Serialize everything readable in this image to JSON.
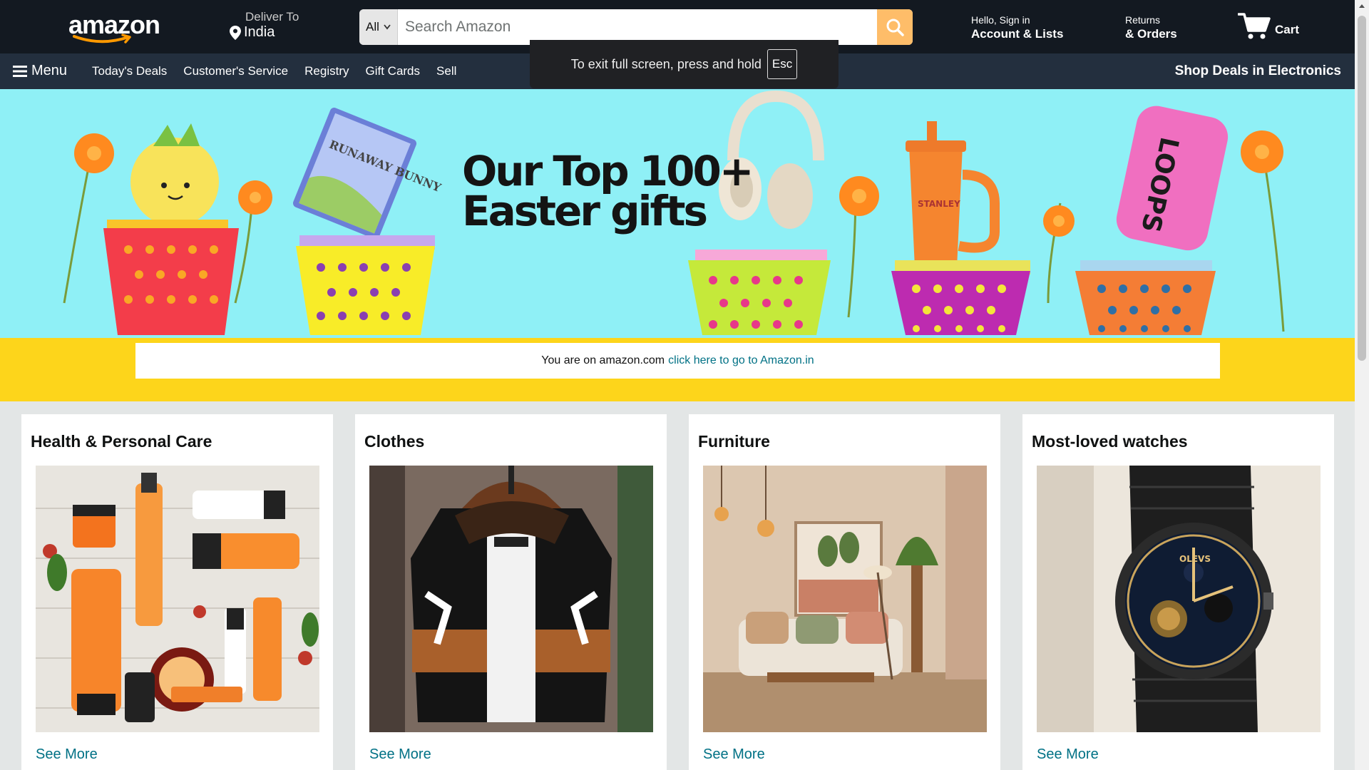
{
  "header": {
    "logo_text": "amazon",
    "deliver_label": "Deliver To",
    "deliver_location": "India",
    "search": {
      "category": "All",
      "placeholder": "Search Amazon"
    },
    "account": {
      "greeting": "Hello, Sign in",
      "label": "Account & Lists"
    },
    "orders": {
      "top": "Returns",
      "label": "& Orders"
    },
    "cart_label": "Cart"
  },
  "subnav": {
    "menu_label": "Menu",
    "links": [
      "Today's Deals",
      "Customer's Service",
      "Registry",
      "Gift Cards",
      "Sell"
    ],
    "promo": "Shop Deals in Electronics"
  },
  "fullscreen_toast": {
    "text": "To exit full screen, press and hold",
    "key": "Esc"
  },
  "hero": {
    "title_line1": "Our Top 100+",
    "title_line2": "Easter gifts",
    "product_labels": [
      "RUNAWAY BUNNY",
      "STANLEY",
      "LOOPS"
    ]
  },
  "locale_notice": {
    "text": "You are on amazon.com",
    "link": "click here to go to Amazon.in"
  },
  "cards": [
    {
      "title": "Health & Personal Care",
      "link": "See More",
      "image": "vitamin-c-skincare-products"
    },
    {
      "title": "Clothes",
      "link": "See More",
      "image": "hooded-jacket"
    },
    {
      "title": "Furniture",
      "link": "See More",
      "image": "living-room-sofa"
    },
    {
      "title": "Most-loved watches",
      "link": "See More",
      "image": "black-chronograph-watch"
    }
  ],
  "colors": {
    "nav_dark": "#131921",
    "nav_sub": "#232f3e",
    "search_button": "#febd69",
    "link": "#007185",
    "hero_sky": "#8ff0f6",
    "hero_floor": "#fdd51b"
  }
}
